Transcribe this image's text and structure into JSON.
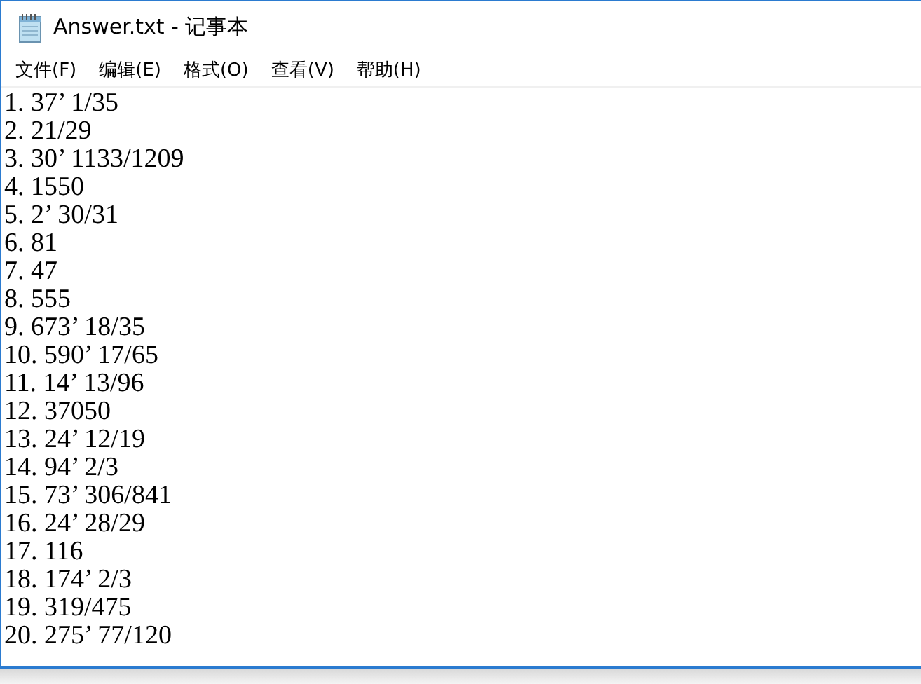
{
  "window": {
    "title": "Answer.txt - 记事本"
  },
  "menu": [
    "文件(F)",
    "编辑(E)",
    "格式(O)",
    "查看(V)",
    "帮助(H)"
  ],
  "lines": [
    "1. 37’ 1/35",
    "2. 21/29",
    "3. 30’ 1133/1209",
    "4. 1550",
    "5. 2’ 30/31",
    "6. 81",
    "7. 47",
    "8. 555",
    "9. 673’ 18/35",
    "10. 590’ 17/65",
    "11. 14’ 13/96",
    "12. 37050",
    "13. 24’ 12/19",
    "14. 94’ 2/3",
    "15. 73’ 306/841",
    "16. 24’ 28/29",
    "17. 116",
    "18. 174’ 2/3",
    "19. 319/475",
    "20. 275’ 77/120"
  ]
}
